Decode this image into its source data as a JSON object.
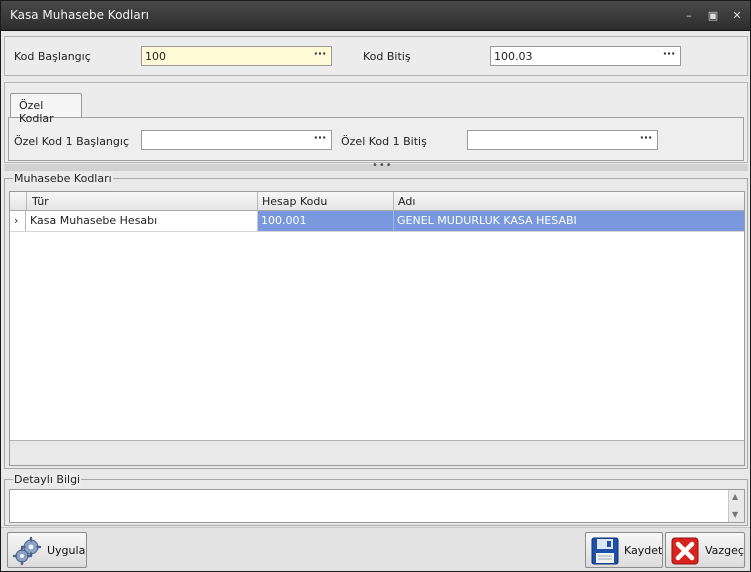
{
  "window": {
    "title": "Kasa Muhasebe Kodları",
    "min": "–",
    "max": "▣",
    "close": "✕"
  },
  "range": {
    "start_label": "Kod Başlangıç",
    "start_value": "100",
    "end_label": "Kod Bitiş",
    "end_value": "100.03",
    "ellipsis": "···"
  },
  "special": {
    "tab_label": "Özel Kodlar",
    "start_label": "Özel Kod 1 Başlangıç",
    "start_value": "",
    "end_label": "Özel Kod 1 Bitiş",
    "end_value": ""
  },
  "splitter": "•••",
  "accounts": {
    "caption": "Muhasebe Kodları",
    "columns": [
      "Tür",
      "Hesap Kodu",
      "Adı"
    ],
    "rows": [
      {
        "indicator": "›",
        "type": "Kasa Muhasebe Hesabı",
        "code": "100.001",
        "name": "GENEL MUDURLUK KASA HESABI"
      }
    ]
  },
  "detail": {
    "caption": "Detaylı Bilgi",
    "up": "▲",
    "down": "▼"
  },
  "buttons": {
    "apply": "Uygula",
    "save": "Kaydet",
    "cancel": "Vazgeç"
  },
  "colors": {
    "selection": "#7a98dd",
    "active_field": "#fffbd6",
    "cancel_red": "#d9231f",
    "save_blue": "#1f4fa6"
  }
}
